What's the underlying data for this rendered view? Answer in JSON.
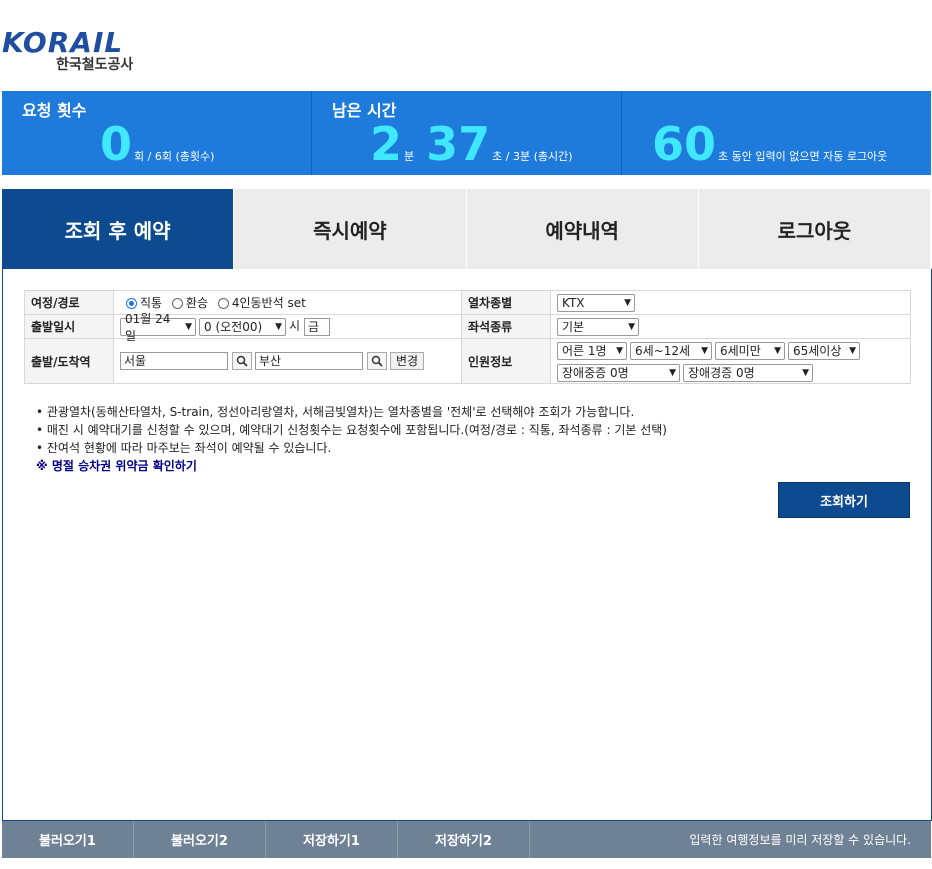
{
  "brand": {
    "logo_text": "KORAIL",
    "subtitle": "한국철도공사"
  },
  "status": {
    "requests": {
      "label": "요청 횟수",
      "value": "0",
      "suffix": "회 / 6회 (총횟수)"
    },
    "remaining": {
      "label": "남은 시간",
      "minutes": "2",
      "min_unit": "분",
      "seconds": "37",
      "sec_suffix": "초 / 3분 (총시간)"
    },
    "logout": {
      "value": "60",
      "suffix": "초 동안 입력이 없으면 자동 로그아웃"
    }
  },
  "tabs": [
    "조회 후 예약",
    "즉시예약",
    "예약내역",
    "로그아웃"
  ],
  "form": {
    "route_label": "여정/경로",
    "route_options": [
      "직통",
      "환승",
      "4인동반석 set"
    ],
    "train_type_label": "열차종별",
    "train_type_value": "KTX",
    "date_label": "출발일시",
    "date_value": "01월 24일",
    "hour_value": "0 (오전00)",
    "hour_unit": "시",
    "weekday": "금",
    "seat_type_label": "좌석종류",
    "seat_type_value": "기본",
    "station_label": "출발/도착역",
    "departure": "서울",
    "arrival": "부산",
    "change_button": "변경",
    "passengers_label": "인원정보",
    "passenger_opts": [
      "어른 1명",
      "6세~12세",
      "6세미만",
      "65세이상",
      "장애중증 0명",
      "장애경증 0명"
    ]
  },
  "notes": [
    "• 관광열차(동해산타열차, S-train, 정선아리랑열차, 서해금빛열차)는 열차종별을 '전체'로 선택해야 조회가 가능합니다.",
    "• 매진 시 예약대기를 신청할 수 있으며, 예약대기 신청횟수는 요청횟수에 포함됩니다.(여정/경로 : 직통, 좌석종류 : 기본 선택)",
    "• 잔여석 현황에 따라 마주보는 좌석이 예약될 수 있습니다."
  ],
  "penalty_link": "※ 명절 승차권 위약금 확인하기",
  "search_button": "조회하기",
  "footer": {
    "buttons": [
      "불러오기1",
      "불러오기2",
      "저장하기1",
      "저장하기2"
    ],
    "note": "입력한 여행정보를 미리 저장할 수 있습니다."
  }
}
